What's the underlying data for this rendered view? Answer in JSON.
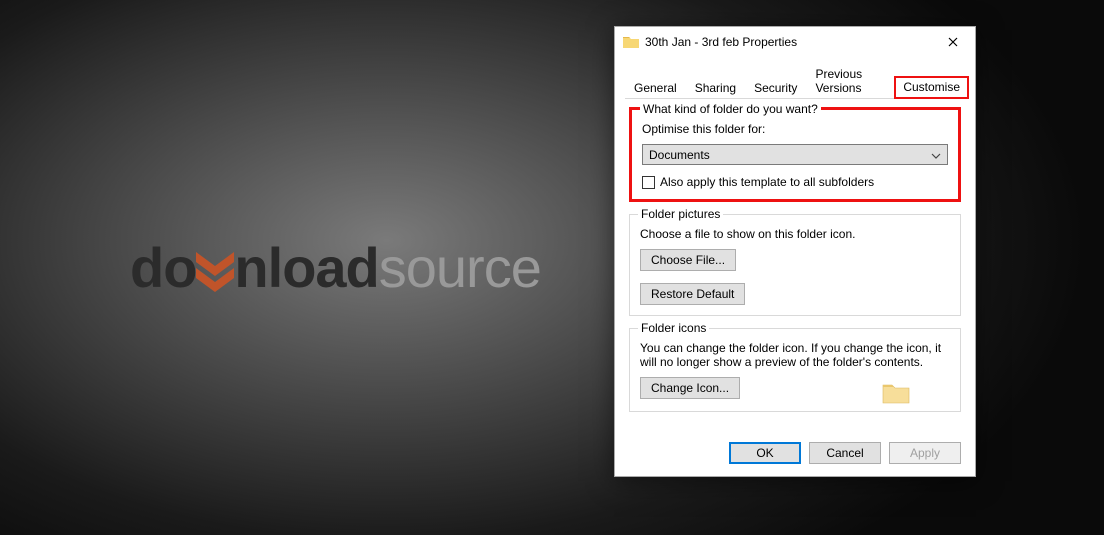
{
  "logo": {
    "part1": "do",
    "part2": "nload",
    "part3": "source"
  },
  "dialog": {
    "title": "30th Jan - 3rd feb Properties",
    "tabs": {
      "general": "General",
      "sharing": "Sharing",
      "security": "Security",
      "previous_versions": "Previous Versions",
      "customise": "Customise"
    },
    "group_kind": {
      "legend": "What kind of folder do you want?",
      "label": "Optimise this folder for:",
      "select_value": "Documents",
      "checkbox_label": "Also apply this template to all subfolders"
    },
    "group_pictures": {
      "legend": "Folder pictures",
      "text": "Choose a file to show on this folder icon.",
      "choose_file": "Choose File...",
      "restore_default": "Restore Default"
    },
    "group_icons": {
      "legend": "Folder icons",
      "text": "You can change the folder icon. If you change the icon, it will no longer show a preview of the folder's contents.",
      "change_icon": "Change Icon..."
    },
    "buttons": {
      "ok": "OK",
      "cancel": "Cancel",
      "apply": "Apply"
    }
  }
}
